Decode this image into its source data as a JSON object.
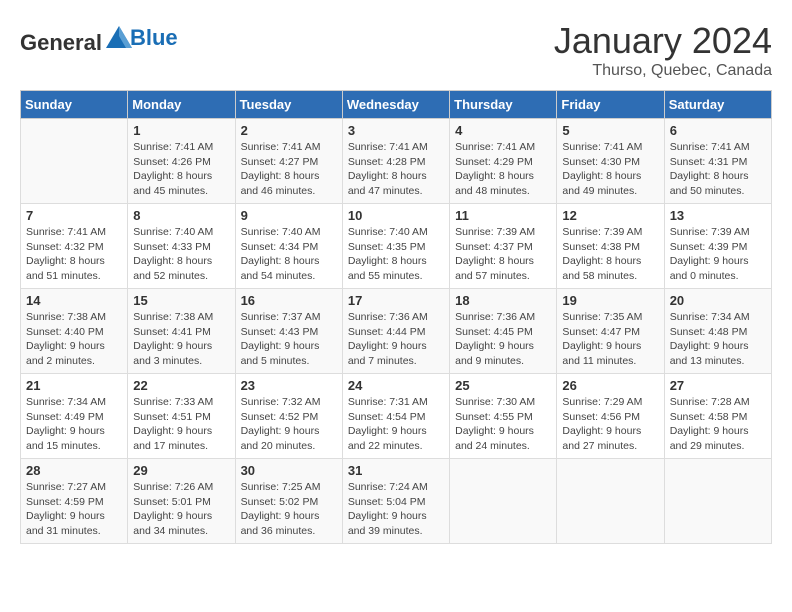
{
  "header": {
    "logo_general": "General",
    "logo_blue": "Blue",
    "month": "January 2024",
    "location": "Thurso, Quebec, Canada"
  },
  "weekdays": [
    "Sunday",
    "Monday",
    "Tuesday",
    "Wednesday",
    "Thursday",
    "Friday",
    "Saturday"
  ],
  "weeks": [
    [
      {
        "day": "",
        "sunrise": "",
        "sunset": "",
        "daylight": ""
      },
      {
        "day": "1",
        "sunrise": "Sunrise: 7:41 AM",
        "sunset": "Sunset: 4:26 PM",
        "daylight": "Daylight: 8 hours and 45 minutes."
      },
      {
        "day": "2",
        "sunrise": "Sunrise: 7:41 AM",
        "sunset": "Sunset: 4:27 PM",
        "daylight": "Daylight: 8 hours and 46 minutes."
      },
      {
        "day": "3",
        "sunrise": "Sunrise: 7:41 AM",
        "sunset": "Sunset: 4:28 PM",
        "daylight": "Daylight: 8 hours and 47 minutes."
      },
      {
        "day": "4",
        "sunrise": "Sunrise: 7:41 AM",
        "sunset": "Sunset: 4:29 PM",
        "daylight": "Daylight: 8 hours and 48 minutes."
      },
      {
        "day": "5",
        "sunrise": "Sunrise: 7:41 AM",
        "sunset": "Sunset: 4:30 PM",
        "daylight": "Daylight: 8 hours and 49 minutes."
      },
      {
        "day": "6",
        "sunrise": "Sunrise: 7:41 AM",
        "sunset": "Sunset: 4:31 PM",
        "daylight": "Daylight: 8 hours and 50 minutes."
      }
    ],
    [
      {
        "day": "7",
        "sunrise": "Sunrise: 7:41 AM",
        "sunset": "Sunset: 4:32 PM",
        "daylight": "Daylight: 8 hours and 51 minutes."
      },
      {
        "day": "8",
        "sunrise": "Sunrise: 7:40 AM",
        "sunset": "Sunset: 4:33 PM",
        "daylight": "Daylight: 8 hours and 52 minutes."
      },
      {
        "day": "9",
        "sunrise": "Sunrise: 7:40 AM",
        "sunset": "Sunset: 4:34 PM",
        "daylight": "Daylight: 8 hours and 54 minutes."
      },
      {
        "day": "10",
        "sunrise": "Sunrise: 7:40 AM",
        "sunset": "Sunset: 4:35 PM",
        "daylight": "Daylight: 8 hours and 55 minutes."
      },
      {
        "day": "11",
        "sunrise": "Sunrise: 7:39 AM",
        "sunset": "Sunset: 4:37 PM",
        "daylight": "Daylight: 8 hours and 57 minutes."
      },
      {
        "day": "12",
        "sunrise": "Sunrise: 7:39 AM",
        "sunset": "Sunset: 4:38 PM",
        "daylight": "Daylight: 8 hours and 58 minutes."
      },
      {
        "day": "13",
        "sunrise": "Sunrise: 7:39 AM",
        "sunset": "Sunset: 4:39 PM",
        "daylight": "Daylight: 9 hours and 0 minutes."
      }
    ],
    [
      {
        "day": "14",
        "sunrise": "Sunrise: 7:38 AM",
        "sunset": "Sunset: 4:40 PM",
        "daylight": "Daylight: 9 hours and 2 minutes."
      },
      {
        "day": "15",
        "sunrise": "Sunrise: 7:38 AM",
        "sunset": "Sunset: 4:41 PM",
        "daylight": "Daylight: 9 hours and 3 minutes."
      },
      {
        "day": "16",
        "sunrise": "Sunrise: 7:37 AM",
        "sunset": "Sunset: 4:43 PM",
        "daylight": "Daylight: 9 hours and 5 minutes."
      },
      {
        "day": "17",
        "sunrise": "Sunrise: 7:36 AM",
        "sunset": "Sunset: 4:44 PM",
        "daylight": "Daylight: 9 hours and 7 minutes."
      },
      {
        "day": "18",
        "sunrise": "Sunrise: 7:36 AM",
        "sunset": "Sunset: 4:45 PM",
        "daylight": "Daylight: 9 hours and 9 minutes."
      },
      {
        "day": "19",
        "sunrise": "Sunrise: 7:35 AM",
        "sunset": "Sunset: 4:47 PM",
        "daylight": "Daylight: 9 hours and 11 minutes."
      },
      {
        "day": "20",
        "sunrise": "Sunrise: 7:34 AM",
        "sunset": "Sunset: 4:48 PM",
        "daylight": "Daylight: 9 hours and 13 minutes."
      }
    ],
    [
      {
        "day": "21",
        "sunrise": "Sunrise: 7:34 AM",
        "sunset": "Sunset: 4:49 PM",
        "daylight": "Daylight: 9 hours and 15 minutes."
      },
      {
        "day": "22",
        "sunrise": "Sunrise: 7:33 AM",
        "sunset": "Sunset: 4:51 PM",
        "daylight": "Daylight: 9 hours and 17 minutes."
      },
      {
        "day": "23",
        "sunrise": "Sunrise: 7:32 AM",
        "sunset": "Sunset: 4:52 PM",
        "daylight": "Daylight: 9 hours and 20 minutes."
      },
      {
        "day": "24",
        "sunrise": "Sunrise: 7:31 AM",
        "sunset": "Sunset: 4:54 PM",
        "daylight": "Daylight: 9 hours and 22 minutes."
      },
      {
        "day": "25",
        "sunrise": "Sunrise: 7:30 AM",
        "sunset": "Sunset: 4:55 PM",
        "daylight": "Daylight: 9 hours and 24 minutes."
      },
      {
        "day": "26",
        "sunrise": "Sunrise: 7:29 AM",
        "sunset": "Sunset: 4:56 PM",
        "daylight": "Daylight: 9 hours and 27 minutes."
      },
      {
        "day": "27",
        "sunrise": "Sunrise: 7:28 AM",
        "sunset": "Sunset: 4:58 PM",
        "daylight": "Daylight: 9 hours and 29 minutes."
      }
    ],
    [
      {
        "day": "28",
        "sunrise": "Sunrise: 7:27 AM",
        "sunset": "Sunset: 4:59 PM",
        "daylight": "Daylight: 9 hours and 31 minutes."
      },
      {
        "day": "29",
        "sunrise": "Sunrise: 7:26 AM",
        "sunset": "Sunset: 5:01 PM",
        "daylight": "Daylight: 9 hours and 34 minutes."
      },
      {
        "day": "30",
        "sunrise": "Sunrise: 7:25 AM",
        "sunset": "Sunset: 5:02 PM",
        "daylight": "Daylight: 9 hours and 36 minutes."
      },
      {
        "day": "31",
        "sunrise": "Sunrise: 7:24 AM",
        "sunset": "Sunset: 5:04 PM",
        "daylight": "Daylight: 9 hours and 39 minutes."
      },
      {
        "day": "",
        "sunrise": "",
        "sunset": "",
        "daylight": ""
      },
      {
        "day": "",
        "sunrise": "",
        "sunset": "",
        "daylight": ""
      },
      {
        "day": "",
        "sunrise": "",
        "sunset": "",
        "daylight": ""
      }
    ]
  ]
}
